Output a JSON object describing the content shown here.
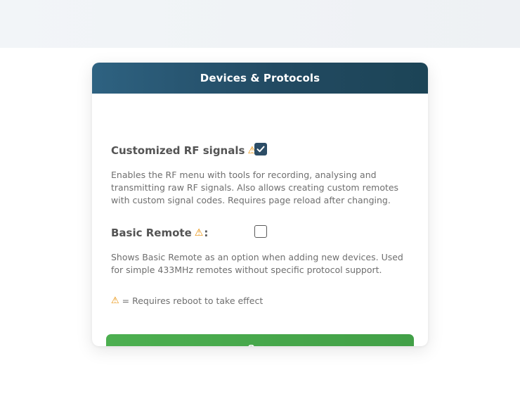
{
  "card": {
    "title": "Devices & Protocols"
  },
  "settings": [
    {
      "label": "Customized RF signals",
      "warning_icon": "warning-triangle-icon",
      "colon": ":",
      "checked": true,
      "description": "Enables the RF menu with tools for recording, analysing and transmitting raw RF signals. Also allows creating custom remotes with custom signal codes. Requires page reload after changing."
    },
    {
      "label": "Basic Remote",
      "warning_icon": "warning-triangle-icon",
      "colon": ":",
      "checked": false,
      "description": "Shows Basic Remote as an option when adding new devices. Used for simple 433MHz remotes without specific protocol support."
    }
  ],
  "legend": {
    "symbol": "⚠",
    "text": "= Requires reboot to take effect"
  },
  "save_button": {
    "label": "Save"
  },
  "colors": {
    "header_start": "#2e6281",
    "header_end": "#1c4456",
    "save_green": "#4caf50",
    "checkbox_checked": "#2c4d66",
    "warning": "#e88d00"
  }
}
